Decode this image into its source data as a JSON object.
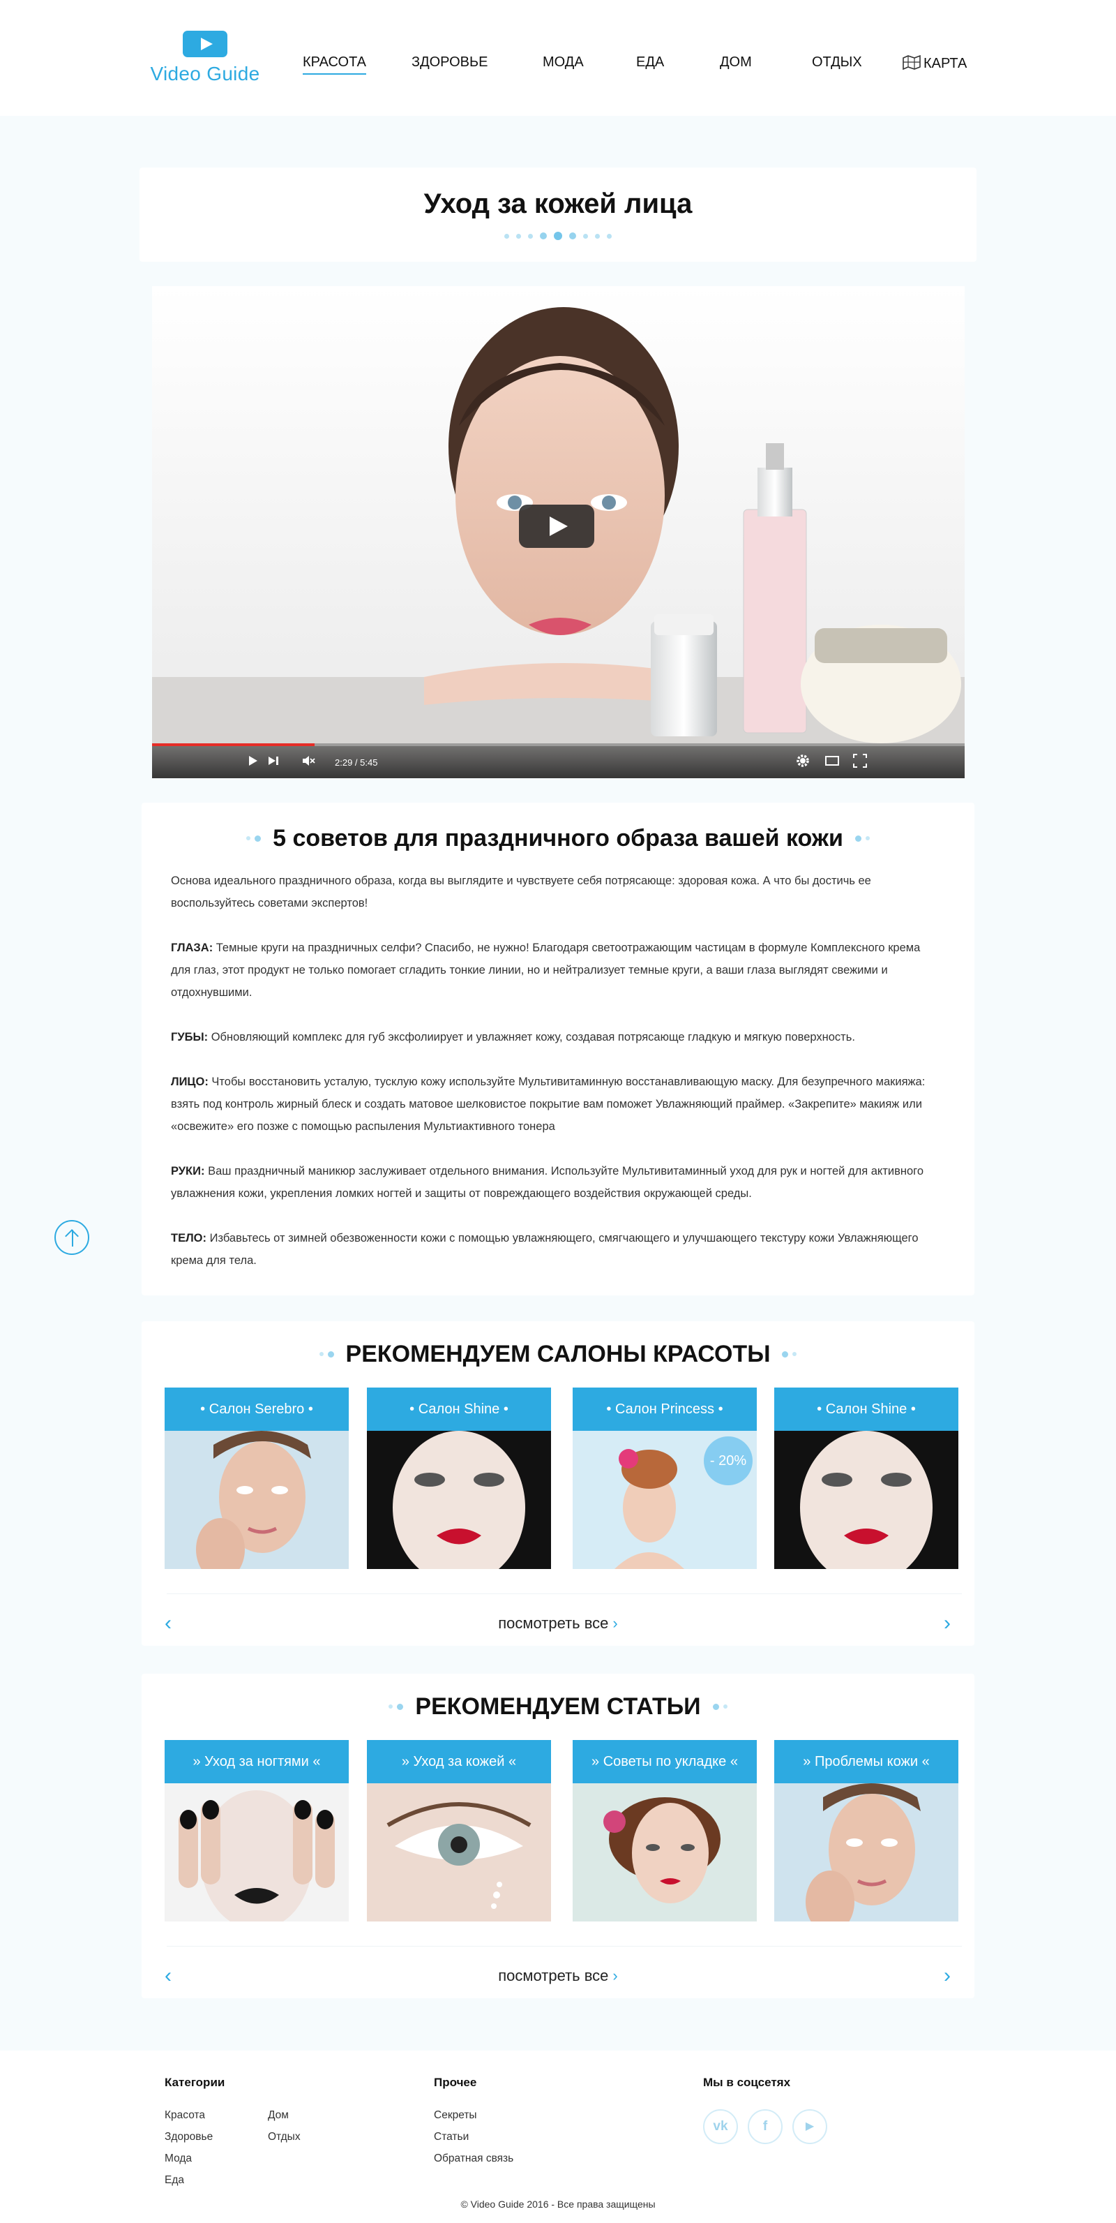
{
  "header": {
    "logo_text": "Video Guide",
    "nav": [
      {
        "label": "КРАСОТА",
        "active": true
      },
      {
        "label": "ЗДОРОВЬЕ"
      },
      {
        "label": "МОДА"
      },
      {
        "label": "ЕДА"
      },
      {
        "label": "ДОМ"
      },
      {
        "label": "ОТДЫХ"
      },
      {
        "label": "КАРТА",
        "icon": "map-icon"
      }
    ]
  },
  "page_title": "Уход за кожей лица",
  "video": {
    "time": "2:29 / 5:45",
    "progress": 0.2,
    "icons": [
      "play-icon",
      "next-icon",
      "mute-icon",
      "settings-icon",
      "theater-icon",
      "fullscreen-icon"
    ]
  },
  "article": {
    "title": "5 советов для праздничного образа вашей кожи",
    "intro": "Основа идеального праздничного образа, когда вы выглядите и чувствуете себя потрясающе: здоровая кожа. А что бы достичь ее воспользуйтесь советами экспертов!",
    "tips": [
      {
        "label": "ГЛАЗА:",
        "text": " Темные круги на праздничных селфи? Спасибо, не нужно! Благодаря светоотражающим частицам в формуле Комплексного крема для глаз, этот продукт не только помогает сгладить тонкие линии, но и нейтрализует темные круги, а ваши глаза выглядят свежими и отдохнувшими."
      },
      {
        "label": "ГУБЫ:",
        "text": "  Обновляющий комплекс для губ эксфолиирует и увлажняет кожу, создавая потрясающе гладкую и мягкую поверхность."
      },
      {
        "label": "ЛИЦО:",
        "text": " Чтобы восстановить  усталую, тусклую кожу используйте Мультивитаминную восстанавливающую маску.  Для безупречного макияжа: взять под контроль жирный блеск и создать матовое шелковистое покрытие вам поможет  Увлажняющий праймер. «Закрепите» макияж или «освежите» его позже с помощью распыления  Мультиактивного тонера"
      },
      {
        "label": "РУКИ:",
        "text": " Ваш праздничный маникюр заслуживает отдельного внимания. Используйте  Мультивитаминный уход для рук и ногтей для активного увлажнения кожи, укрепления ломких ногтей и защиты от повреждающего воздействия окружающей среды."
      },
      {
        "label": "ТЕЛО:",
        "text": " Избавьтесь от зимней обезвоженности кожи с помощью увлажняющего, смягчающего и улучшающего текстуру кожи Увлажняющего крема для тела."
      }
    ]
  },
  "salons": {
    "title": "РЕКОМЕНДУЕМ САЛОНЫ КРАСОТЫ",
    "items": [
      {
        "label": "• Салон Serebro •"
      },
      {
        "label": "• Салон Shine •"
      },
      {
        "label": "• Салон Princess •",
        "badge": "- 20%"
      },
      {
        "label": "• Салон Shine •"
      }
    ],
    "see_all": "посмотреть все"
  },
  "articles": {
    "title": "РЕКОМЕНДУЕМ СТАТЬИ",
    "items": [
      {
        "label": "» Уход за ногтями «"
      },
      {
        "label": "» Уход за кожей «"
      },
      {
        "label": "» Советы по укладке «"
      },
      {
        "label": "» Проблемы кожи «"
      }
    ],
    "see_all": "посмотреть все"
  },
  "footer": {
    "categories_title": "Категории",
    "categories": [
      "Красота",
      "Дом",
      "Здоровье",
      "Отдых",
      "Мода",
      "Еда"
    ],
    "other_title": "Прочее",
    "other": [
      "Секреты",
      "Статьи",
      "Обратная связь"
    ],
    "social_title": "Мы в соцсетях",
    "social": [
      {
        "label": "vk",
        "icon": "vk-icon"
      },
      {
        "label": "f",
        "icon": "facebook-icon"
      },
      {
        "label": "▶",
        "icon": "youtube-icon"
      }
    ],
    "copyright": "© Video Guide  2016 - Все права защищены"
  }
}
